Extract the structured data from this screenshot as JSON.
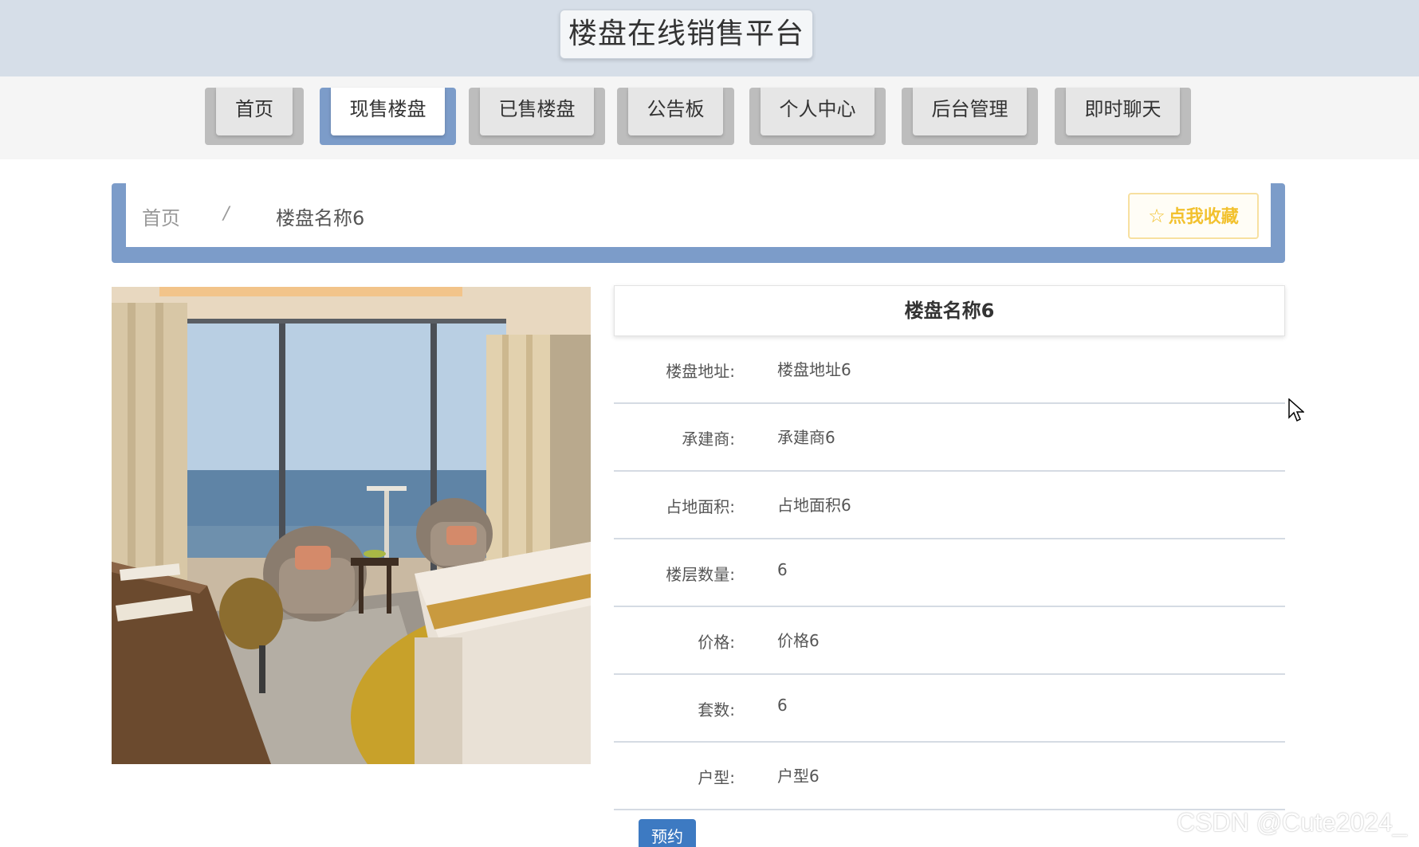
{
  "header": {
    "site_title": "楼盘在线销售平台"
  },
  "nav": {
    "items": [
      {
        "label": "首页",
        "active": false
      },
      {
        "label": "现售楼盘",
        "active": true
      },
      {
        "label": "已售楼盘",
        "active": false
      },
      {
        "label": "公告板",
        "active": false
      },
      {
        "label": "个人中心",
        "active": false
      },
      {
        "label": "后台管理",
        "active": false
      },
      {
        "label": "即时聊天",
        "active": false
      }
    ]
  },
  "breadcrumb": {
    "home": "首页",
    "separator": "/",
    "current": "楼盘名称6"
  },
  "favorite": {
    "label": "点我收藏",
    "icon": "star-outline-icon"
  },
  "detail": {
    "name": "楼盘名称6",
    "rows": [
      {
        "label": "楼盘地址:",
        "value": "楼盘地址6"
      },
      {
        "label": "承建商:",
        "value": "承建商6"
      },
      {
        "label": "占地面积:",
        "value": "占地面积6"
      },
      {
        "label": "楼层数量:",
        "value": "6"
      },
      {
        "label": "价格:",
        "value": "价格6"
      },
      {
        "label": "套数:",
        "value": "6"
      },
      {
        "label": "户型:",
        "value": "户型6"
      }
    ],
    "book_label": "预约"
  },
  "watermark": "CSDN @Cute2024_",
  "colors": {
    "accent": "#7c9cc9",
    "favorite": "#f2c12e",
    "book_button": "#3d7ac2"
  }
}
